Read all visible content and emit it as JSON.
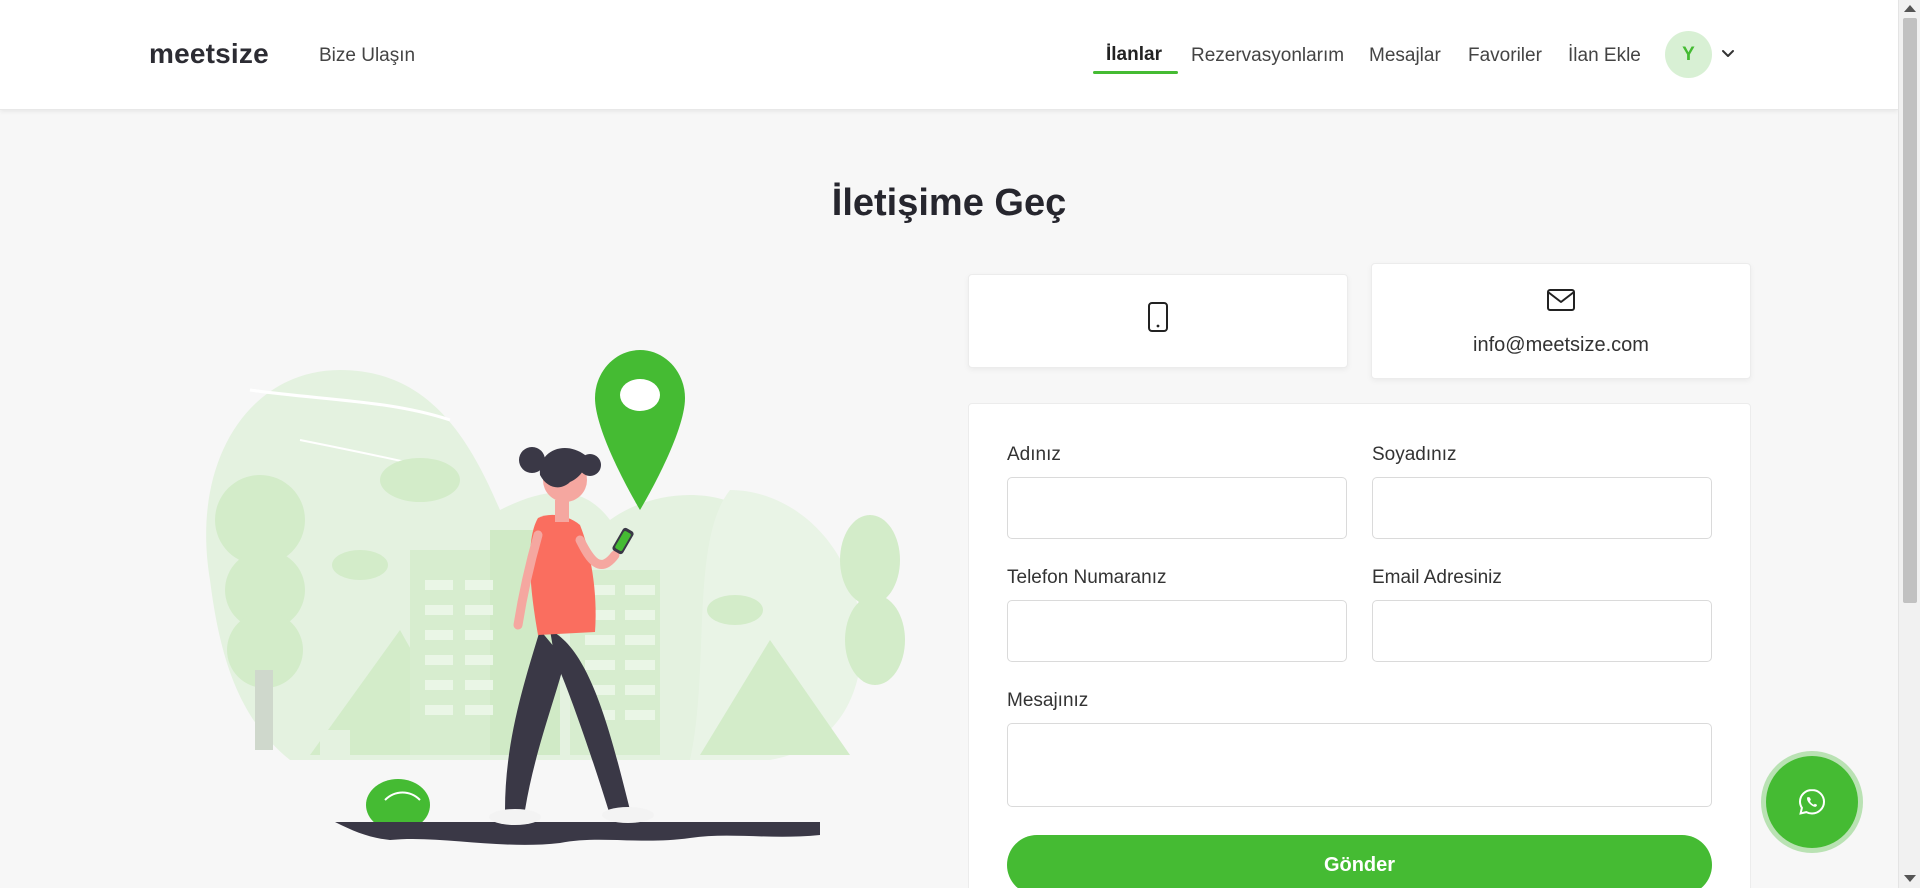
{
  "header": {
    "logo": "meetsize",
    "contact_link": "Bize Ulaşın",
    "nav": [
      {
        "label": "İlanlar",
        "active": true
      },
      {
        "label": "Rezervasyonlarım",
        "active": false
      },
      {
        "label": "Mesajlar",
        "active": false
      },
      {
        "label": "Favoriler",
        "active": false
      },
      {
        "label": "İlan Ekle",
        "active": false
      }
    ],
    "avatar_initial": "Y",
    "accent_color": "#45bb33"
  },
  "page": {
    "title": "İletişime Geç"
  },
  "contact_cards": {
    "phone": {
      "icon": "phone-icon",
      "text": ""
    },
    "email": {
      "icon": "mail-icon",
      "text": "info@meetsize.com"
    }
  },
  "form": {
    "first_name_label": "Adınız",
    "first_name_value": "",
    "last_name_label": "Soyadınız",
    "last_name_value": "",
    "phone_label": "Telefon Numaranız",
    "phone_value": "",
    "email_label": "Email Adresiniz",
    "email_value": "",
    "message_label": "Mesajınız",
    "message_value": "",
    "submit_label": "Gönder"
  },
  "floating": {
    "whatsapp_icon": "whatsapp-icon"
  }
}
